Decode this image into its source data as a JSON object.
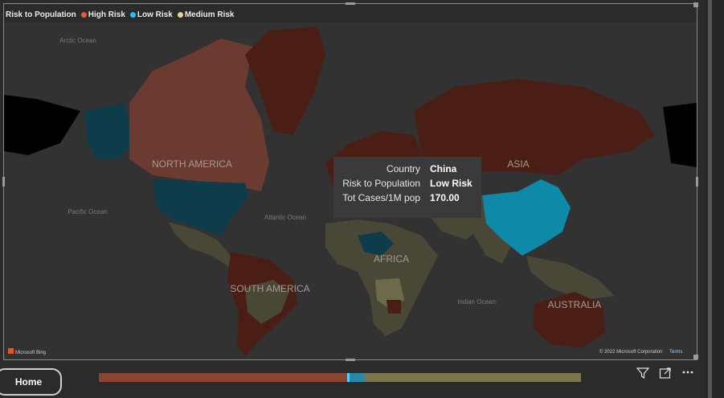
{
  "legend": {
    "title": "Risk to Population",
    "items": [
      {
        "label": "High Risk",
        "color": "#e8583a"
      },
      {
        "label": "Low Risk",
        "color": "#1cc3f0"
      },
      {
        "label": "Medium Risk",
        "color": "#e6d68a"
      }
    ]
  },
  "map": {
    "ocean_labels": {
      "arctic": "Arctic Ocean",
      "pacific": "Pacific Ocean",
      "atlantic": "Atlantic Ocean",
      "indian": "Indian Ocean"
    },
    "continent_labels": {
      "north_america": "NORTH AMERICA",
      "south_america": "SOUTH AMERICA",
      "asia": "ASIA",
      "africa": "AFRICA",
      "australia": "AUSTRALIA"
    },
    "provider": "Microsoft Bing",
    "copyright": "© 2022 Microsoft Corporation",
    "terms": "Terms",
    "colors": {
      "high": "#4a1e14",
      "high_light": "#6b3a30",
      "low": "#0f3c4a",
      "low_bright": "#0e8aa8",
      "medium": "#494836",
      "medium_light": "#6d6a4c",
      "ocean": "#323232"
    }
  },
  "tooltip": {
    "rows": [
      {
        "key": "Country",
        "value": "China"
      },
      {
        "key": "Risk to Population",
        "value": "Low Risk"
      },
      {
        "key": "Tot Cases/1M pop",
        "value": "170.00"
      }
    ]
  },
  "home_button": {
    "label": "Home"
  },
  "slider": {
    "high_fraction": 0.515,
    "low_fraction": 0.035,
    "medium_fraction": 0.45
  },
  "toolbar": {
    "filter_icon": "filter-icon",
    "focus_icon": "focus-mode-icon",
    "more_icon": "more-options-icon"
  }
}
